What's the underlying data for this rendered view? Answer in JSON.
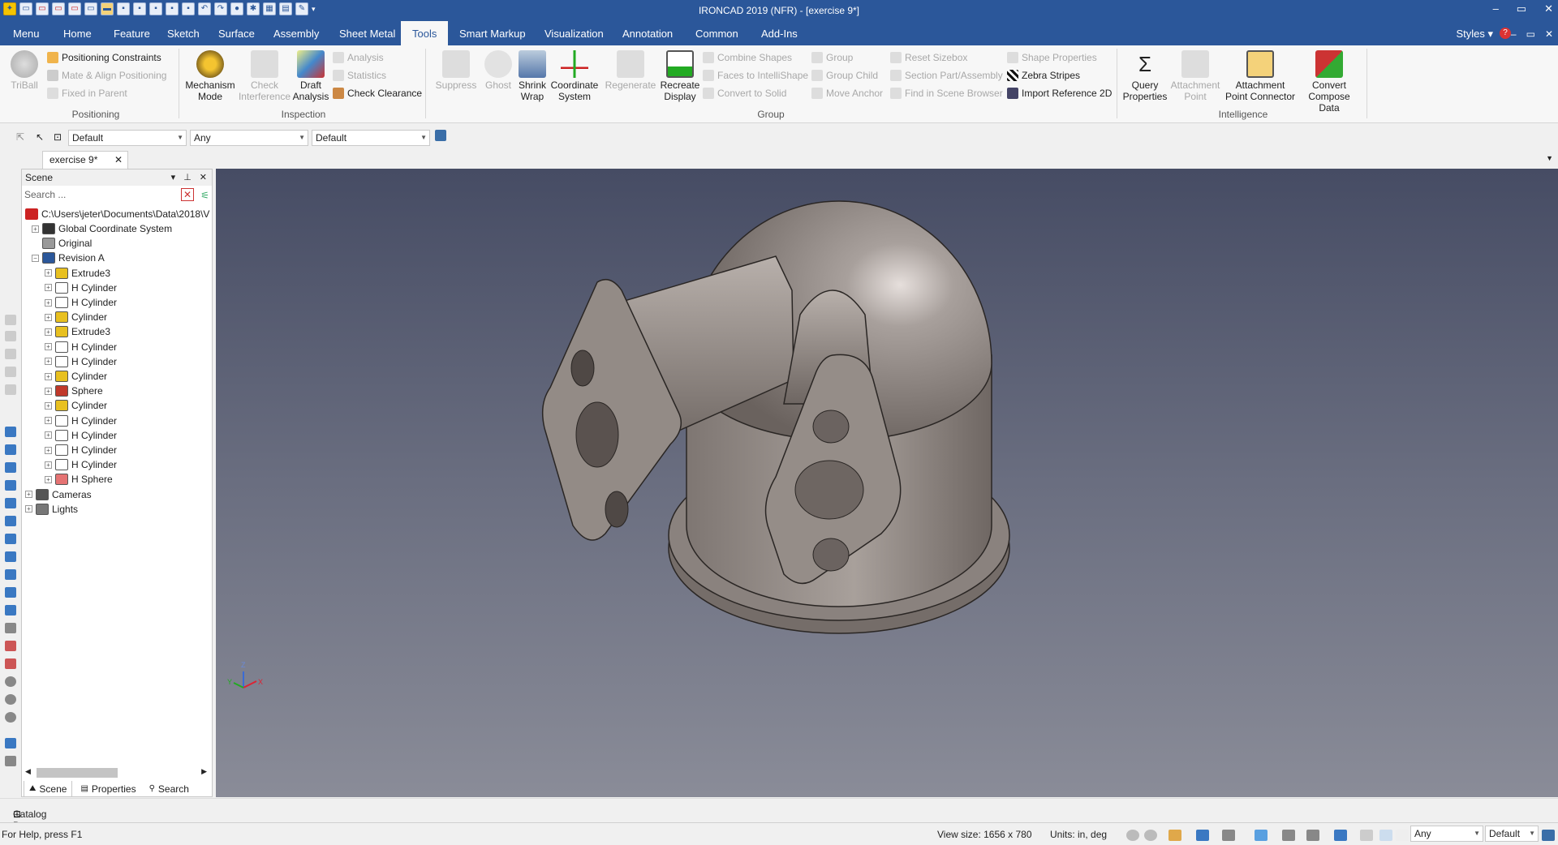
{
  "window": {
    "title": "IRONCAD 2019 (NFR) - [exercise 9*]",
    "min": "–",
    "restore": "▭",
    "close": "✕"
  },
  "menu": {
    "tabs": [
      "Menu",
      "Home",
      "Feature",
      "Sketch",
      "Surface",
      "Assembly",
      "Sheet Metal",
      "Tools",
      "Smart Markup",
      "Visualization",
      "Annotation",
      "Common",
      "Add-Ins"
    ],
    "active": "Tools",
    "styles": "Styles",
    "mdi": {
      "min": "–",
      "restore": "▭",
      "close": "✕"
    }
  },
  "ribbon": {
    "positioning": {
      "group": "Positioning",
      "triball": "TriBall",
      "constraints": "Positioning Constraints",
      "mate": "Mate & Align Positioning",
      "fixed": "Fixed in Parent"
    },
    "inspection": {
      "group": "Inspection",
      "mechanism": "Mechanism\nMode",
      "check": "Check\nInterference",
      "draft": "Draft\nAnalysis",
      "analysis": "Analysis",
      "statistics": "Statistics",
      "clearance": "Check Clearance"
    },
    "operations": {
      "group": "Group",
      "suppress": "Suppress",
      "ghost": "Ghost",
      "shrink": "Shrink\nWrap",
      "coord": "Coordinate\nSystem",
      "regen": "Regenerate",
      "recreate": "Recreate\nDisplay",
      "combine": "Combine Shapes",
      "faces": "Faces to IntelliShape",
      "convert": "Convert to Solid",
      "groupchild": "Group Child",
      "anchor": "Move Anchor",
      "sizebox": "Reset Sizebox",
      "section": "Section Part/Assembly",
      "find": "Find in Scene Browser",
      "shapeprops": "Shape Properties",
      "zebra": "Zebra Stripes",
      "importref": "Import Reference 2D"
    },
    "intelligence": {
      "group": "Intelligence",
      "query": "Query\nProperties",
      "attachpt": "Attachment\nPoint",
      "attachconn": "Attachment\nPoint Connector",
      "compose": "Convert\nCompose Data"
    }
  },
  "selection": {
    "default1": "Default",
    "any": "Any",
    "default2": "Default"
  },
  "doc_tab": {
    "label": "exercise 9*",
    "close": "✕"
  },
  "scene": {
    "header": "Scene",
    "search_placeholder": "Search ...",
    "path": "C:\\Users\\jeter\\Documents\\Data\\2018\\V",
    "nodes": [
      {
        "label": "Global Coordinate System",
        "level": 1,
        "exp": "+",
        "icon": "coord"
      },
      {
        "label": "Original",
        "level": 1,
        "exp": "",
        "icon": "orig"
      },
      {
        "label": "Revision A",
        "level": 1,
        "exp": "−",
        "icon": "rev"
      },
      {
        "label": "Extrude3",
        "level": 2,
        "exp": "+",
        "icon": "feat"
      },
      {
        "label": "H Cylinder",
        "level": 2,
        "exp": "+",
        "icon": "hole"
      },
      {
        "label": "H Cylinder",
        "level": 2,
        "exp": "+",
        "icon": "hole"
      },
      {
        "label": "Cylinder",
        "level": 2,
        "exp": "+",
        "icon": "feat"
      },
      {
        "label": "Extrude3",
        "level": 2,
        "exp": "+",
        "icon": "feat"
      },
      {
        "label": "H Cylinder",
        "level": 2,
        "exp": "+",
        "icon": "hole"
      },
      {
        "label": "H Cylinder",
        "level": 2,
        "exp": "+",
        "icon": "hole"
      },
      {
        "label": "Cylinder",
        "level": 2,
        "exp": "+",
        "icon": "feat"
      },
      {
        "label": "Sphere",
        "level": 2,
        "exp": "+",
        "icon": "sphere"
      },
      {
        "label": "Cylinder",
        "level": 2,
        "exp": "+",
        "icon": "feat"
      },
      {
        "label": "H Cylinder",
        "level": 2,
        "exp": "+",
        "icon": "hole"
      },
      {
        "label": "H Cylinder",
        "level": 2,
        "exp": "+",
        "icon": "hole"
      },
      {
        "label": "H Cylinder",
        "level": 2,
        "exp": "+",
        "icon": "hole"
      },
      {
        "label": "H Cylinder",
        "level": 2,
        "exp": "+",
        "icon": "hole"
      },
      {
        "label": "H Sphere",
        "level": 2,
        "exp": "+",
        "icon": "hsphere"
      },
      {
        "label": "Cameras",
        "level": 0,
        "exp": "+",
        "icon": "cam"
      },
      {
        "label": "Lights",
        "level": 0,
        "exp": "+",
        "icon": "light"
      }
    ],
    "tabs": {
      "scene": "Scene",
      "properties": "Properties",
      "search": "Search"
    }
  },
  "catalog": "Catalog Browser",
  "status": {
    "help": "For Help, press F1",
    "viewsize": "View size: 1656 x 780",
    "units": "Units: in, deg",
    "any": "Any",
    "default": "Default"
  },
  "axis": {
    "z": "Z",
    "x": "X",
    "y": "Y"
  }
}
